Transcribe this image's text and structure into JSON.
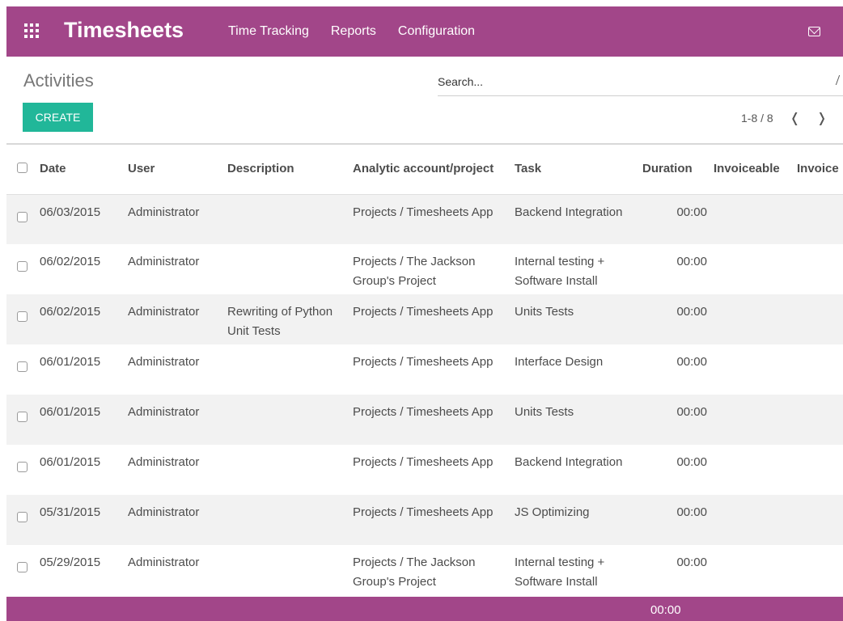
{
  "header": {
    "brand": "Timesheets",
    "menu": [
      "Time Tracking",
      "Reports",
      "Configuration"
    ],
    "accent": "#a24689"
  },
  "control": {
    "title": "Activities",
    "search_placeholder": "Search...",
    "create_label": "CREATE",
    "pager": "1-8 / 8",
    "create_color": "#21b799"
  },
  "table": {
    "columns": [
      "Date",
      "User",
      "Description",
      "Analytic account/project",
      "Task",
      "Duration",
      "Invoiceable",
      "Invoice"
    ],
    "rows": [
      {
        "date": "06/03/2015",
        "user": "Administrator",
        "description": "",
        "project": "Projects / Timesheets App",
        "task": "Backend Integration",
        "duration": "00:00"
      },
      {
        "date": "06/02/2015",
        "user": "Administrator",
        "description": "",
        "project": "Projects / The Jackson Group's Project",
        "task": "Internal testing + Software Install",
        "duration": "00:00"
      },
      {
        "date": "06/02/2015",
        "user": "Administrator",
        "description": "Rewriting of Python Unit Tests",
        "project": "Projects / Timesheets App",
        "task": "Units Tests",
        "duration": "00:00"
      },
      {
        "date": "06/01/2015",
        "user": "Administrator",
        "description": "",
        "project": "Projects / Timesheets App",
        "task": "Interface Design",
        "duration": "00:00"
      },
      {
        "date": "06/01/2015",
        "user": "Administrator",
        "description": "",
        "project": "Projects / Timesheets App",
        "task": "Units Tests",
        "duration": "00:00"
      },
      {
        "date": "06/01/2015",
        "user": "Administrator",
        "description": "",
        "project": "Projects / Timesheets App",
        "task": "Backend Integration",
        "duration": "00:00"
      },
      {
        "date": "05/31/2015",
        "user": "Administrator",
        "description": "",
        "project": "Projects / Timesheets App",
        "task": "JS Optimizing",
        "duration": "00:00"
      },
      {
        "date": "05/29/2015",
        "user": "Administrator",
        "description": "",
        "project": "Projects / The Jackson Group's Project",
        "task": "Internal testing + Software Install",
        "duration": "00:00"
      }
    ],
    "total_duration": "00:00"
  },
  "icons": [
    "apps-grid-icon",
    "mail-icon",
    "search-icon",
    "chevron-left-icon",
    "chevron-right-icon"
  ]
}
